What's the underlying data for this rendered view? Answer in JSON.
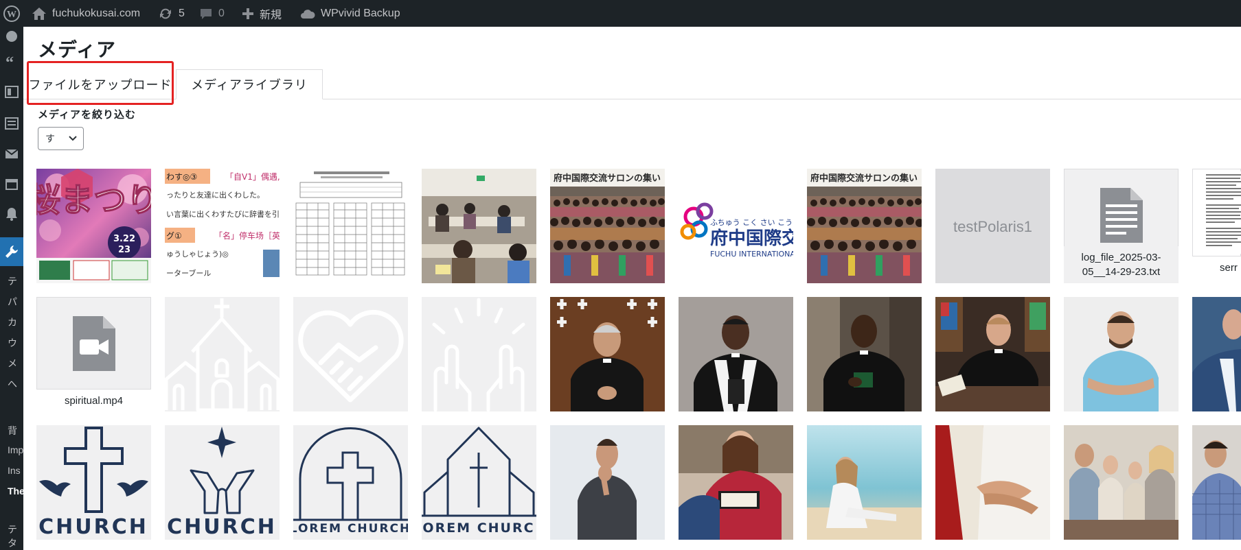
{
  "admin_bar": {
    "site_name": "fuchukokusai.com",
    "updates_count": "5",
    "comments_count": "0",
    "new_label": "新規",
    "backup_label": "WPvivid Backup"
  },
  "sidebar": {
    "labels": [
      "テ",
      "パ",
      "カ",
      "ウ",
      "メ",
      "へ",
      "背",
      "Imp",
      "Ins",
      "The",
      "テ",
      "タ"
    ]
  },
  "modal": {
    "title": "メディア",
    "tabs": [
      {
        "label": "ファイルをアップロード",
        "highlighted": true
      },
      {
        "label": "メディアライブラリ",
        "active": true
      }
    ],
    "filter": {
      "label": "メディアを絞り込む",
      "selected": "す"
    }
  },
  "media": {
    "items": [
      {
        "kind": "image",
        "desc": "sakura-festival-poster",
        "overlay_text": "桜まつり",
        "date_text_1": "3.22",
        "date_text_2": "23"
      },
      {
        "kind": "image",
        "desc": "japanese-vocab-worksheet",
        "line1": "わす◎③",
        "line2": "「自V1」偶遇,",
        "line3": "ったりと友達に出くわした。",
        "line4": "い言葉に出くわすたびに辞書を引く。",
        "line5": "グ①",
        "line6": "「名」停车场［英",
        "line7": "ゅうしゃじょう)◎",
        "line8": "ーターブール"
      },
      {
        "kind": "image",
        "desc": "schedule-document"
      },
      {
        "kind": "image",
        "desc": "classroom-photo"
      },
      {
        "kind": "image",
        "desc": "group-photo-salon",
        "banner": "府中国際交流サロンの集い"
      },
      {
        "kind": "image",
        "desc": "fuchu-international-logo",
        "ruby": "ふちゅう こく さい こう",
        "jp": "府中国際交",
        "en": "FUCHU INTERNATIONA"
      },
      {
        "kind": "image",
        "desc": "group-photo-salon-2",
        "banner": "府中国際交流サロンの集い"
      },
      {
        "kind": "placeholder",
        "text": "testPolaris1"
      },
      {
        "kind": "file",
        "filename": "log_file_2025-03-05__14-29-23.txt"
      },
      {
        "kind": "doc-partial",
        "filename": "serr"
      },
      {
        "kind": "video",
        "filename": "spiritual.mp4"
      },
      {
        "kind": "icon",
        "desc": "church-outline-icon"
      },
      {
        "kind": "icon",
        "desc": "heart-handshake-icon"
      },
      {
        "kind": "icon",
        "desc": "praying-hands-icon"
      },
      {
        "kind": "image",
        "desc": "priest-photo-1"
      },
      {
        "kind": "image",
        "desc": "priest-photo-2"
      },
      {
        "kind": "image",
        "desc": "priest-photo-3"
      },
      {
        "kind": "image",
        "desc": "priest-photo-4"
      },
      {
        "kind": "image",
        "desc": "smiling-man-photo"
      },
      {
        "kind": "image",
        "desc": "man-blue-suit-partial"
      },
      {
        "kind": "logo",
        "desc": "church-logo-cross-doves",
        "text": "CHURCH"
      },
      {
        "kind": "logo",
        "desc": "church-logo-praying-hands",
        "text": "CHURCH"
      },
      {
        "kind": "logo",
        "desc": "lorem-church-logo-arch",
        "text": "LOREM CHURCH"
      },
      {
        "kind": "logo",
        "desc": "lorem-church-logo-building",
        "text": "OREM CHURC"
      },
      {
        "kind": "image",
        "desc": "thinking-man-photo"
      },
      {
        "kind": "image",
        "desc": "woman-reading-bible-photo"
      },
      {
        "kind": "image",
        "desc": "woman-by-sea-photo"
      },
      {
        "kind": "image",
        "desc": "jesus-holding-hands-photo"
      },
      {
        "kind": "image",
        "desc": "family-praying-photo"
      },
      {
        "kind": "image",
        "desc": "men-reading-partial"
      }
    ]
  }
}
